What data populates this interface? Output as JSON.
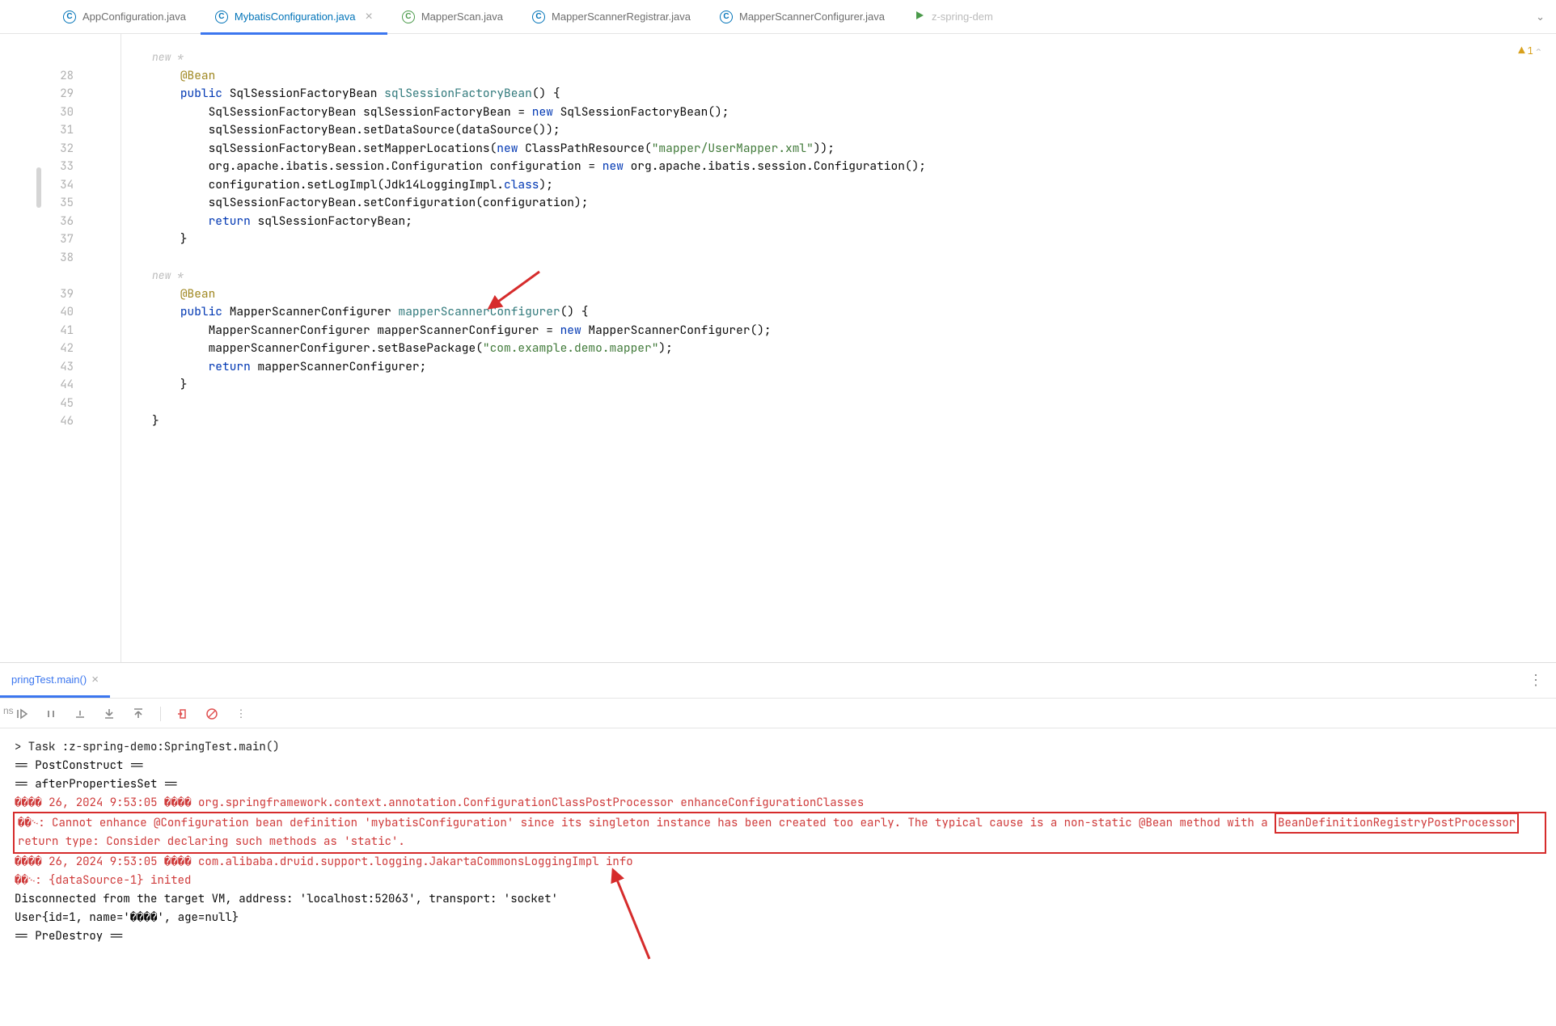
{
  "tabs": [
    {
      "icon": "C",
      "iconClass": "tab-icon-blue",
      "label": "AppConfiguration.java"
    },
    {
      "icon": "C",
      "iconClass": "tab-icon-blue",
      "label": "MybatisConfiguration.java",
      "active": true,
      "closable": true
    },
    {
      "icon": "C",
      "iconClass": "tab-icon-green",
      "label": "MapperScan.java"
    },
    {
      "icon": "C",
      "iconClass": "tab-icon-blue",
      "label": "MapperScannerRegistrar.java"
    },
    {
      "icon": "C",
      "iconClass": "tab-icon-blue",
      "label": "MapperScannerConfigurer.java"
    },
    {
      "icon": "▸",
      "iconClass": "tab-icon-run",
      "label": "z-spring-dem",
      "dimmed": true
    }
  ],
  "warning_count": "1",
  "gutter_lines": [
    "",
    "28",
    "29",
    "30",
    "31",
    "32",
    "33",
    "34",
    "35",
    "36",
    "37",
    "38",
    "",
    "39",
    "40",
    "41",
    "42",
    "43",
    "44",
    "45",
    "46"
  ],
  "code_lines": [
    {
      "hint": "new *"
    },
    {
      "tokens": [
        [
          "    ",
          "p"
        ],
        [
          "@Bean",
          "anno"
        ]
      ]
    },
    {
      "tokens": [
        [
          "    ",
          "p"
        ],
        [
          "public",
          "kw"
        ],
        [
          " SqlSessionFactoryBean ",
          "p"
        ],
        [
          "sqlSessionFactoryBean",
          "fn"
        ],
        [
          "() {",
          "p"
        ]
      ]
    },
    {
      "tokens": [
        [
          "        SqlSessionFactoryBean sqlSessionFactoryBean = ",
          "p"
        ],
        [
          "new",
          "kw"
        ],
        [
          " SqlSessionFactoryBean();",
          "p"
        ]
      ]
    },
    {
      "tokens": [
        [
          "        sqlSessionFactoryBean.setDataSource(dataSource());",
          "p"
        ]
      ]
    },
    {
      "tokens": [
        [
          "        sqlSessionFactoryBean.setMapperLocations(",
          "p"
        ],
        [
          "new",
          "kw"
        ],
        [
          " ClassPathResource(",
          "p"
        ],
        [
          "\"mapper/UserMapper.xml\"",
          "str"
        ],
        [
          "));",
          "p"
        ]
      ]
    },
    {
      "tokens": [
        [
          "        org.apache.ibatis.session.Configuration configuration = ",
          "p"
        ],
        [
          "new",
          "kw"
        ],
        [
          " org.apache.ibatis.session.Configuration();",
          "p"
        ]
      ]
    },
    {
      "tokens": [
        [
          "        configuration.setLogImpl(Jdk14LoggingImpl.",
          "p"
        ],
        [
          "class",
          "kw"
        ],
        [
          ");",
          "p"
        ]
      ]
    },
    {
      "tokens": [
        [
          "        sqlSessionFactoryBean.setConfiguration(configuration);",
          "p"
        ]
      ]
    },
    {
      "tokens": [
        [
          "        ",
          "p"
        ],
        [
          "return",
          "kw"
        ],
        [
          " sqlSessionFactoryBean;",
          "p"
        ]
      ]
    },
    {
      "tokens": [
        [
          "    }",
          "p"
        ]
      ]
    },
    {
      "tokens": [
        [
          "",
          "p"
        ]
      ]
    },
    {
      "hint": "new *"
    },
    {
      "tokens": [
        [
          "    ",
          "p"
        ],
        [
          "@Bean",
          "anno"
        ]
      ]
    },
    {
      "tokens": [
        [
          "    ",
          "p"
        ],
        [
          "public",
          "kw"
        ],
        [
          " MapperScannerConfigurer ",
          "p"
        ],
        [
          "mapperScannerConfigurer",
          "fn"
        ],
        [
          "() {",
          "p"
        ]
      ]
    },
    {
      "tokens": [
        [
          "        MapperScannerConfigurer mapperScannerConfigurer = ",
          "p"
        ],
        [
          "new",
          "kw"
        ],
        [
          " MapperScannerConfigurer();",
          "p"
        ]
      ]
    },
    {
      "tokens": [
        [
          "        mapperScannerConfigurer.setBasePackage(",
          "p"
        ],
        [
          "\"com.example.demo.mapper\"",
          "str"
        ],
        [
          ");",
          "p"
        ]
      ]
    },
    {
      "tokens": [
        [
          "        ",
          "p"
        ],
        [
          "return",
          "kw"
        ],
        [
          " mapperScannerConfigurer;",
          "p"
        ]
      ]
    },
    {
      "tokens": [
        [
          "    }",
          "p"
        ]
      ]
    },
    {
      "tokens": [
        [
          "",
          "p"
        ]
      ]
    },
    {
      "tokens": [
        [
          "}",
          "p"
        ]
      ]
    }
  ],
  "run": {
    "tab_label": "pringTest.main()",
    "side_label": "ns",
    "lines": [
      {
        "cls": "c-task",
        "text": "> Task :z-spring-demo:SpringTest.main()"
      },
      {
        "cls": "c-dark",
        "text": "== PostConstruct =="
      },
      {
        "cls": "c-dark",
        "text": "== afterPropertiesSet =="
      },
      {
        "cls": "c-err",
        "text": "���� 26, 2024 9:53:05 ���� org.springframework.context.annotation.ConfigurationClassPostProcessor enhanceConfigurationClasses"
      },
      {
        "cls": "c-err hi",
        "pre": "��࿙: Cannot enhance @Configuration bean definition 'mybatisConfiguration' since its singleton instance has been created too early. The typical cause is a non-static @Bean method with a ",
        "box": "BeanDefinitionRegistryPostProcessor",
        "post": " return type: Consider declaring such methods as 'static'."
      },
      {
        "cls": "c-err",
        "text": "���� 26, 2024 9:53:05 ���� com.alibaba.druid.support.logging.JakartaCommonsLoggingImpl info"
      },
      {
        "cls": "c-err",
        "text": "��࿙: {dataSource-1} inited"
      },
      {
        "cls": "c-dark",
        "text": "Disconnected from the target VM, address: 'localhost:52063', transport: 'socket'"
      },
      {
        "cls": "c-dark",
        "text": "User{id=1, name='����', age=null}"
      },
      {
        "cls": "c-dark",
        "text": "== PreDestroy =="
      }
    ]
  }
}
